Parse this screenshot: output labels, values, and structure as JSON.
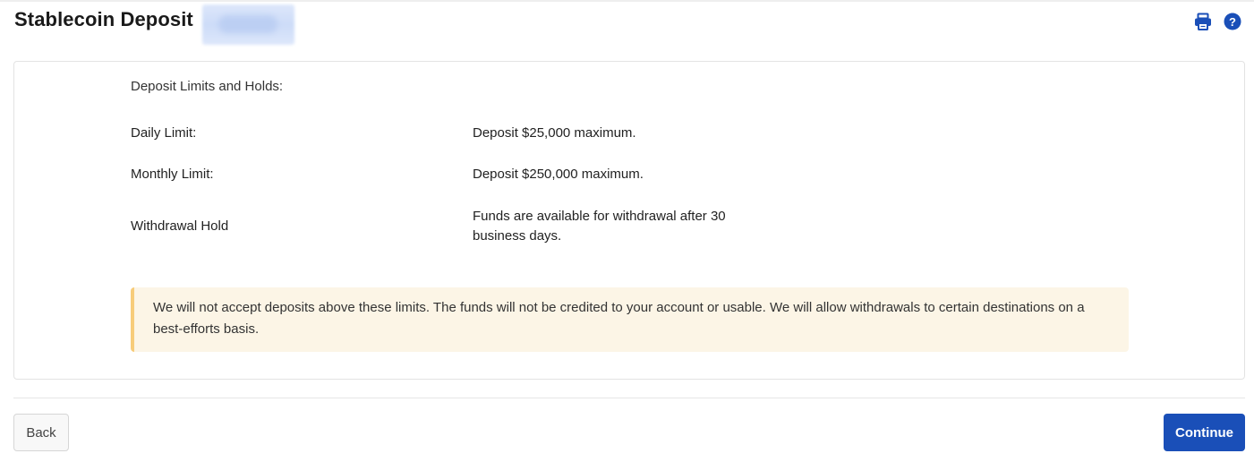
{
  "header": {
    "title": "Stablecoin Deposit",
    "print_icon": "print-icon",
    "help_icon": "help-icon"
  },
  "limits": {
    "heading": "Deposit Limits and Holds:",
    "rows": [
      {
        "label": "Daily Limit:",
        "value": "Deposit $25,000 maximum."
      },
      {
        "label": "Monthly Limit:",
        "value": "Deposit $250,000 maximum."
      },
      {
        "label": "Withdrawal Hold",
        "value": "Funds are available for withdrawal after 30 business days."
      }
    ]
  },
  "notice": {
    "text": "We will not accept deposits above these limits. The funds will not be credited to your account or usable. We will allow withdrawals to certain destinations on a best-efforts basis."
  },
  "footer": {
    "back_label": "Back",
    "continue_label": "Continue"
  },
  "colors": {
    "accent": "#1a4fb8",
    "notice_background": "#fcf5e6",
    "notice_border": "#f7cc7a"
  }
}
